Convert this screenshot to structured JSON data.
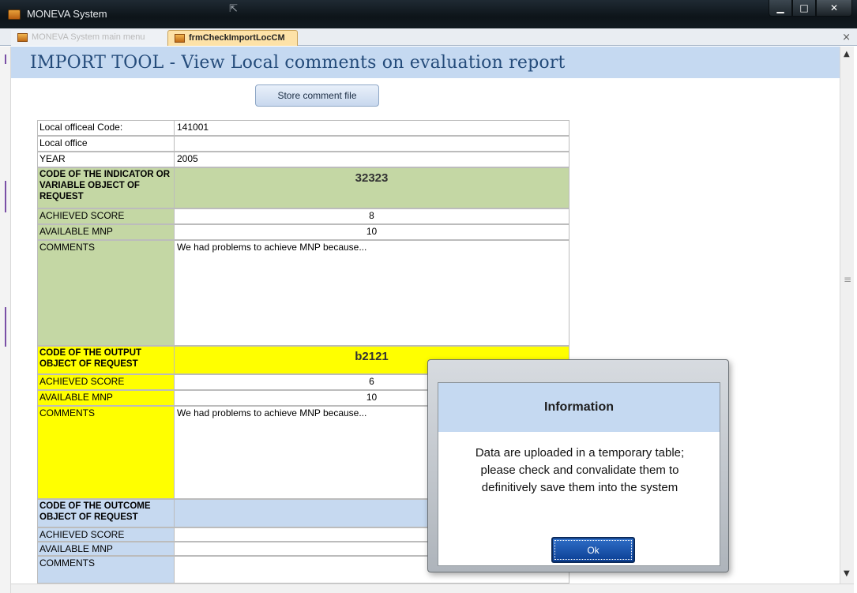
{
  "window": {
    "title": "MONEVA System",
    "buttons": {
      "minimize": "▁",
      "maximize": "□",
      "close": "✕"
    }
  },
  "tabs": [
    {
      "label": "MONEVA System main menu",
      "active": false
    },
    {
      "label": "frmCheckImportLocCM",
      "active": true
    }
  ],
  "tab_close": "×",
  "header": {
    "title": "IMPORT TOOL - View Local comments on evaluation report"
  },
  "toolbar": {
    "store_label": "Store comment file"
  },
  "form": {
    "local_code_label": "Local officeal Code:",
    "local_code_value": "141001",
    "local_office_label": "Local office",
    "local_office_value": "",
    "year_label": "YEAR",
    "year_value": "2005",
    "sections": [
      {
        "header_label": "CODE OF THE INDICATOR OR VARIABLE OBJECT OF REQUEST",
        "code": "32323",
        "achieved_label": "ACHIEVED SCORE",
        "achieved_value": "8",
        "mnp_label": "AVAILABLE MNP",
        "mnp_value": "10",
        "comments_label": "COMMENTS",
        "comments_value": "We had problems to achieve MNP because...",
        "color": "#c4d7a4"
      },
      {
        "header_label": "CODE OF THE OUTPUT OBJECT OF REQUEST",
        "code": "b2121",
        "achieved_label": "ACHIEVED SCORE",
        "achieved_value": "6",
        "mnp_label": "AVAILABLE MNP",
        "mnp_value": "10",
        "comments_label": "COMMENTS",
        "comments_value": "We had problems to achieve MNP because...",
        "color": "#ffff00"
      },
      {
        "header_label": "CODE OF THE OUTCOME OBJECT OF REQUEST",
        "code": "",
        "achieved_label": "ACHIEVED SCORE",
        "achieved_value": "",
        "mnp_label": "AVAILABLE MNP",
        "mnp_value": "",
        "comments_label": "COMMENTS",
        "comments_value": "",
        "color": "#c6d9f0"
      }
    ]
  },
  "dialog": {
    "title": "Information",
    "message_line1": "Data are uploaded in a temporary table;",
    "message_line2": "please check and convalidate them to",
    "message_line3": "definitively save them into the system",
    "ok_label": "Ok"
  },
  "scrollbar": {
    "up": "▲",
    "down": "▼",
    "grip": "≡"
  }
}
